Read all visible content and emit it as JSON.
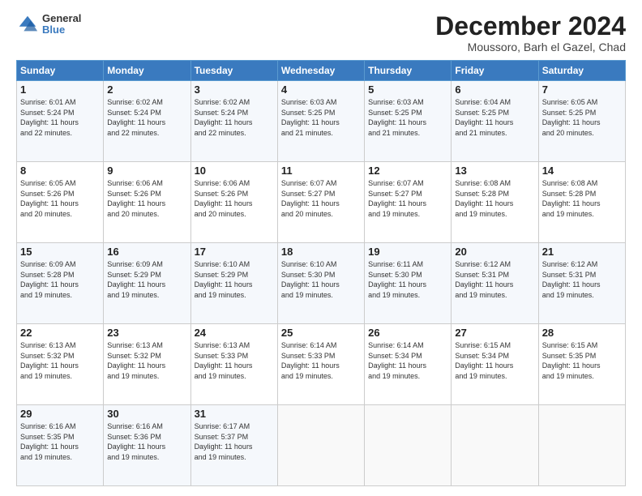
{
  "logo": {
    "general": "General",
    "blue": "Blue"
  },
  "header": {
    "month": "December 2024",
    "location": "Moussoro, Barh el Gazel, Chad"
  },
  "weekdays": [
    "Sunday",
    "Monday",
    "Tuesday",
    "Wednesday",
    "Thursday",
    "Friday",
    "Saturday"
  ],
  "weeks": [
    [
      {
        "day": "1",
        "detail": "Sunrise: 6:01 AM\nSunset: 5:24 PM\nDaylight: 11 hours\nand 22 minutes."
      },
      {
        "day": "2",
        "detail": "Sunrise: 6:02 AM\nSunset: 5:24 PM\nDaylight: 11 hours\nand 22 minutes."
      },
      {
        "day": "3",
        "detail": "Sunrise: 6:02 AM\nSunset: 5:24 PM\nDaylight: 11 hours\nand 22 minutes."
      },
      {
        "day": "4",
        "detail": "Sunrise: 6:03 AM\nSunset: 5:25 PM\nDaylight: 11 hours\nand 21 minutes."
      },
      {
        "day": "5",
        "detail": "Sunrise: 6:03 AM\nSunset: 5:25 PM\nDaylight: 11 hours\nand 21 minutes."
      },
      {
        "day": "6",
        "detail": "Sunrise: 6:04 AM\nSunset: 5:25 PM\nDaylight: 11 hours\nand 21 minutes."
      },
      {
        "day": "7",
        "detail": "Sunrise: 6:05 AM\nSunset: 5:25 PM\nDaylight: 11 hours\nand 20 minutes."
      }
    ],
    [
      {
        "day": "8",
        "detail": "Sunrise: 6:05 AM\nSunset: 5:26 PM\nDaylight: 11 hours\nand 20 minutes."
      },
      {
        "day": "9",
        "detail": "Sunrise: 6:06 AM\nSunset: 5:26 PM\nDaylight: 11 hours\nand 20 minutes."
      },
      {
        "day": "10",
        "detail": "Sunrise: 6:06 AM\nSunset: 5:26 PM\nDaylight: 11 hours\nand 20 minutes."
      },
      {
        "day": "11",
        "detail": "Sunrise: 6:07 AM\nSunset: 5:27 PM\nDaylight: 11 hours\nand 20 minutes."
      },
      {
        "day": "12",
        "detail": "Sunrise: 6:07 AM\nSunset: 5:27 PM\nDaylight: 11 hours\nand 19 minutes."
      },
      {
        "day": "13",
        "detail": "Sunrise: 6:08 AM\nSunset: 5:28 PM\nDaylight: 11 hours\nand 19 minutes."
      },
      {
        "day": "14",
        "detail": "Sunrise: 6:08 AM\nSunset: 5:28 PM\nDaylight: 11 hours\nand 19 minutes."
      }
    ],
    [
      {
        "day": "15",
        "detail": "Sunrise: 6:09 AM\nSunset: 5:28 PM\nDaylight: 11 hours\nand 19 minutes."
      },
      {
        "day": "16",
        "detail": "Sunrise: 6:09 AM\nSunset: 5:29 PM\nDaylight: 11 hours\nand 19 minutes."
      },
      {
        "day": "17",
        "detail": "Sunrise: 6:10 AM\nSunset: 5:29 PM\nDaylight: 11 hours\nand 19 minutes."
      },
      {
        "day": "18",
        "detail": "Sunrise: 6:10 AM\nSunset: 5:30 PM\nDaylight: 11 hours\nand 19 minutes."
      },
      {
        "day": "19",
        "detail": "Sunrise: 6:11 AM\nSunset: 5:30 PM\nDaylight: 11 hours\nand 19 minutes."
      },
      {
        "day": "20",
        "detail": "Sunrise: 6:12 AM\nSunset: 5:31 PM\nDaylight: 11 hours\nand 19 minutes."
      },
      {
        "day": "21",
        "detail": "Sunrise: 6:12 AM\nSunset: 5:31 PM\nDaylight: 11 hours\nand 19 minutes."
      }
    ],
    [
      {
        "day": "22",
        "detail": "Sunrise: 6:13 AM\nSunset: 5:32 PM\nDaylight: 11 hours\nand 19 minutes."
      },
      {
        "day": "23",
        "detail": "Sunrise: 6:13 AM\nSunset: 5:32 PM\nDaylight: 11 hours\nand 19 minutes."
      },
      {
        "day": "24",
        "detail": "Sunrise: 6:13 AM\nSunset: 5:33 PM\nDaylight: 11 hours\nand 19 minutes."
      },
      {
        "day": "25",
        "detail": "Sunrise: 6:14 AM\nSunset: 5:33 PM\nDaylight: 11 hours\nand 19 minutes."
      },
      {
        "day": "26",
        "detail": "Sunrise: 6:14 AM\nSunset: 5:34 PM\nDaylight: 11 hours\nand 19 minutes."
      },
      {
        "day": "27",
        "detail": "Sunrise: 6:15 AM\nSunset: 5:34 PM\nDaylight: 11 hours\nand 19 minutes."
      },
      {
        "day": "28",
        "detail": "Sunrise: 6:15 AM\nSunset: 5:35 PM\nDaylight: 11 hours\nand 19 minutes."
      }
    ],
    [
      {
        "day": "29",
        "detail": "Sunrise: 6:16 AM\nSunset: 5:35 PM\nDaylight: 11 hours\nand 19 minutes."
      },
      {
        "day": "30",
        "detail": "Sunrise: 6:16 AM\nSunset: 5:36 PM\nDaylight: 11 hours\nand 19 minutes."
      },
      {
        "day": "31",
        "detail": "Sunrise: 6:17 AM\nSunset: 5:37 PM\nDaylight: 11 hours\nand 19 minutes."
      },
      null,
      null,
      null,
      null
    ]
  ]
}
